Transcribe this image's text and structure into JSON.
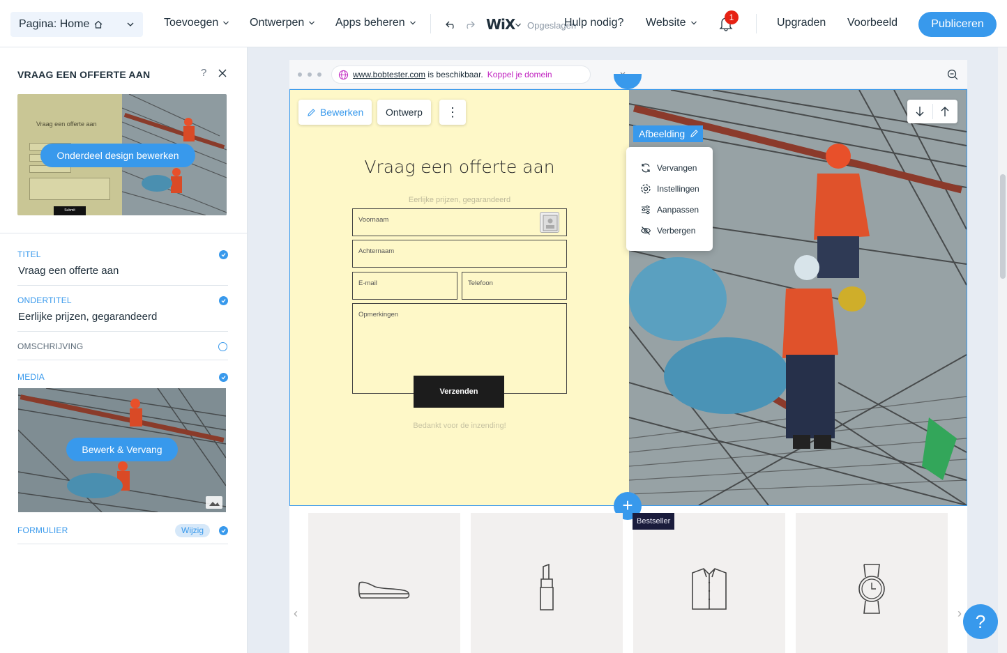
{
  "topbar": {
    "page_label": "Pagina: Home",
    "menu": [
      "Toevoegen",
      "Ontwerpen",
      "Apps beheren"
    ],
    "logo": "WiX",
    "saved_status": "Opgeslagen",
    "help": "Hulp nodig?",
    "website": "Website",
    "notification_count": "1",
    "upgrade": "Upgraden",
    "preview": "Voorbeeld",
    "publish": "Publiceren"
  },
  "panel": {
    "title": "VRAAG EEN OFFERTE AAN",
    "help": "?",
    "preview_title": "Vraag een offerte aan",
    "preview_submit": "Submit",
    "edit_design_button": "Onderdeel design bewerken",
    "sections": {
      "titel": {
        "label": "TITEL",
        "value": "Vraag een offerte aan",
        "checked": true
      },
      "ondertitel": {
        "label": "ONDERTITEL",
        "value": "Eerlijke prijzen, gegarandeerd",
        "checked": true
      },
      "omschrijving": {
        "label": "OMSCHRIJVING",
        "checked": false
      },
      "media": {
        "label": "MEDIA",
        "button": "Bewerk & Vervang",
        "checked": true
      },
      "formulier": {
        "label": "FORMULIER",
        "button": "Wijzig",
        "checked": true
      }
    }
  },
  "browser": {
    "url": "www.bobtester.com",
    "available_text": "is beschikbaar.",
    "connect_link": "Koppel je domein"
  },
  "section": {
    "edit_button": "Bewerken",
    "design_button": "Ontwerp",
    "more": "⋮",
    "form": {
      "title": "Vraag een offerte aan",
      "subtitle": "Eerlijke prijzen, gegarandeerd",
      "fields": {
        "first_name": "Voornaam",
        "last_name": "Achternaam",
        "email": "E-mail",
        "phone": "Telefoon",
        "remarks": "Opmerkingen"
      },
      "submit": "Verzenden",
      "thanks": "Bedankt voor de inzending!"
    },
    "image_tag": "Afbeelding",
    "context_menu": [
      "Vervangen",
      "Instellingen",
      "Aanpassen",
      "Verbergen"
    ]
  },
  "products": {
    "badge": "Bestseller",
    "items": [
      "shoe-icon",
      "lipstick-icon",
      "shirt-icon",
      "watch-icon"
    ]
  },
  "colors": {
    "accent": "#3899ec",
    "form_bg": "#fef8c8",
    "badge": "#e62214"
  }
}
